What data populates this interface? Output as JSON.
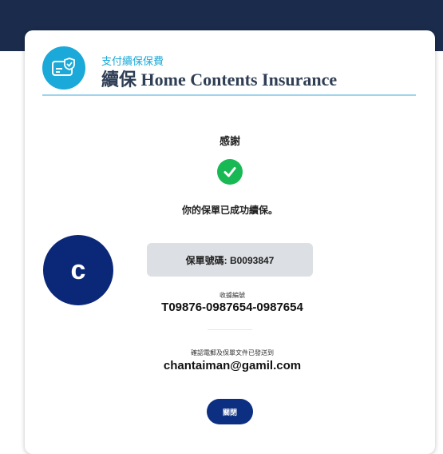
{
  "header": {
    "subtitle": "支付續保保費",
    "title": "續保 Home Contents Insurance",
    "icon": "card-check-icon"
  },
  "confirmation": {
    "thanks": "感謝",
    "icon": "check-circle-icon",
    "success_message": "你的保單已成功續保。",
    "policy_number": "保單號碼: B0093847"
  },
  "avatar": {
    "initial": "c"
  },
  "receipt": {
    "label": "收據編號",
    "number": "T09876-0987654-0987654"
  },
  "email": {
    "label": "確認電郵及保單文件已發送到",
    "address": "chantaiman@gamil.com"
  },
  "actions": {
    "close_label": "關閉"
  },
  "colors": {
    "top_band": "#1a2b4c",
    "accent": "#1aa9d8",
    "success": "#18b955",
    "primary_button": "#0d2f82",
    "avatar": "#0b2878"
  }
}
